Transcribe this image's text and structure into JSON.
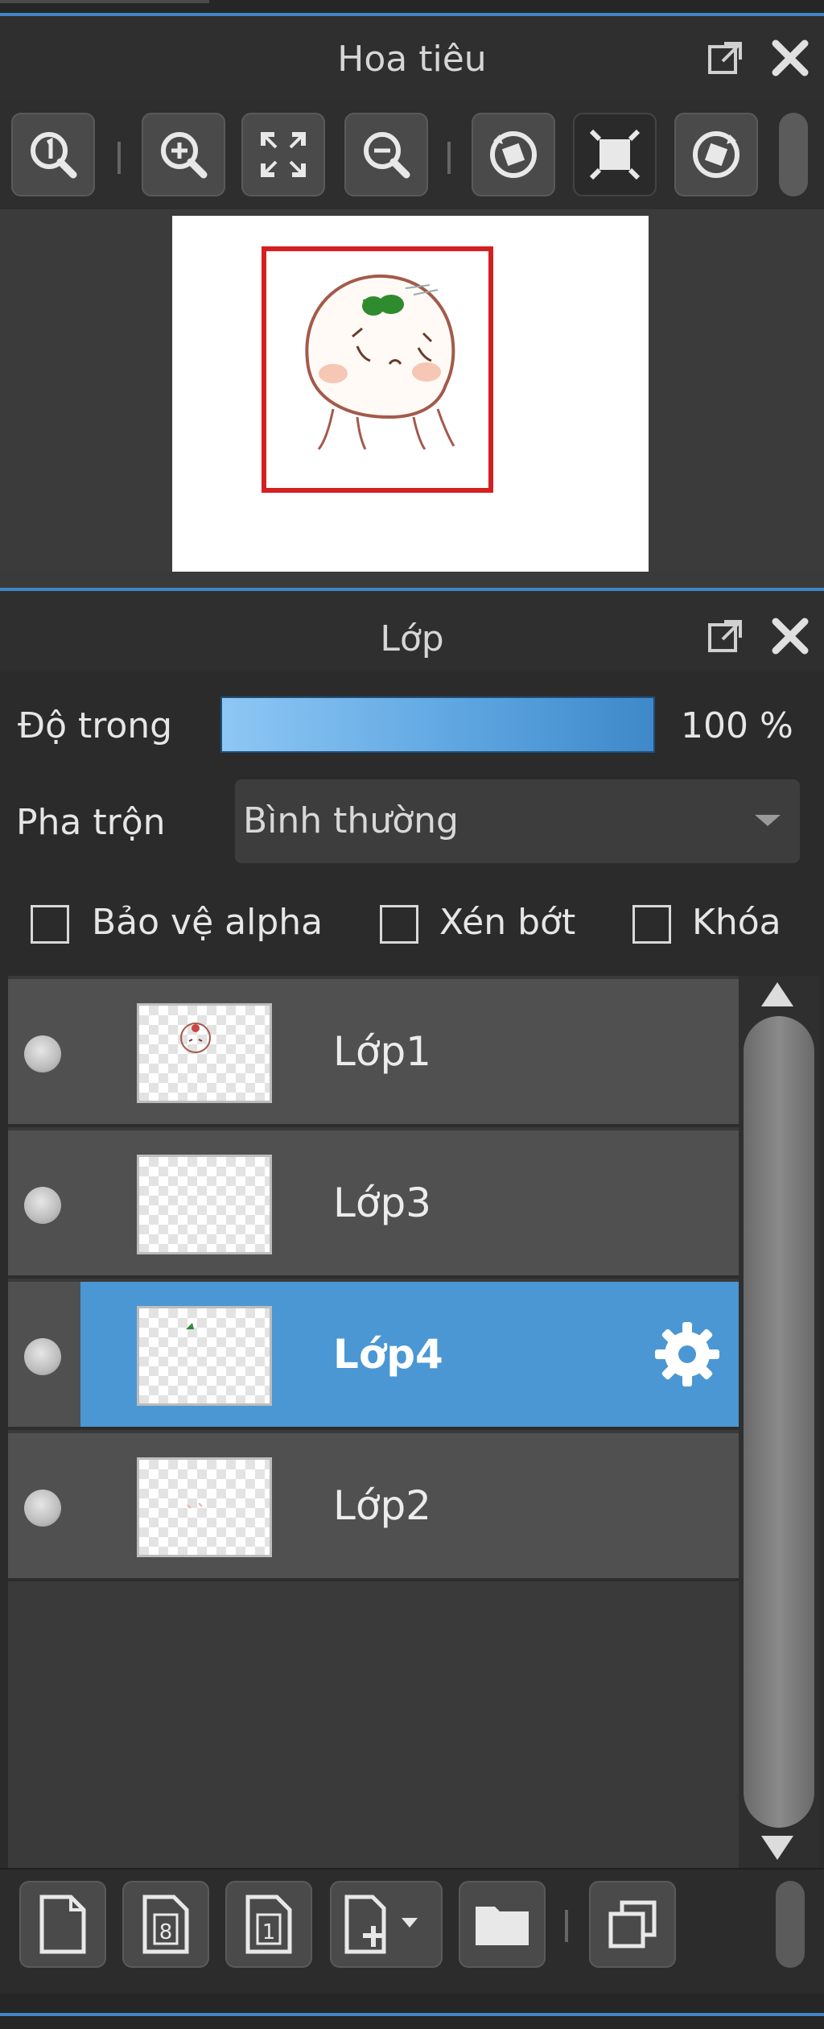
{
  "navigator": {
    "title": "Hoa tiêu",
    "toolbar": [
      {
        "name": "zoom-actual-icon"
      },
      {
        "name": "zoom-in-icon"
      },
      {
        "name": "fit-screen-icon"
      },
      {
        "name": "zoom-out-icon"
      },
      {
        "name": "rotate-left-icon"
      },
      {
        "name": "flip-frame-icon"
      },
      {
        "name": "rotate-right-icon"
      }
    ]
  },
  "layers_panel": {
    "title": "Lớp",
    "opacity_label": "Độ trong",
    "opacity_value": "100 %",
    "opacity_fraction": 1.0,
    "blend_label": "Pha trộn",
    "blend_value": "Bình thường",
    "checkboxes": {
      "protect_alpha": "Bảo vệ alpha",
      "clipping": "Xén bớt",
      "lock": "Khóa"
    },
    "layers": [
      {
        "name": "Lớp1",
        "selected": false
      },
      {
        "name": "Lớp3",
        "selected": false
      },
      {
        "name": "Lớp4",
        "selected": true
      },
      {
        "name": "Lớp2",
        "selected": false
      }
    ],
    "bottom_toolbar": [
      {
        "name": "new-layer-icon"
      },
      {
        "name": "new-8bit-layer-icon"
      },
      {
        "name": "new-1bit-layer-icon"
      },
      {
        "name": "add-layer-dropdown-icon"
      },
      {
        "name": "folder-icon"
      },
      {
        "name": "duplicate-layer-icon"
      }
    ]
  },
  "colors": {
    "accent": "#4a97d4",
    "panel_bg": "#2b2b2b",
    "frame_red": "#d42020"
  }
}
